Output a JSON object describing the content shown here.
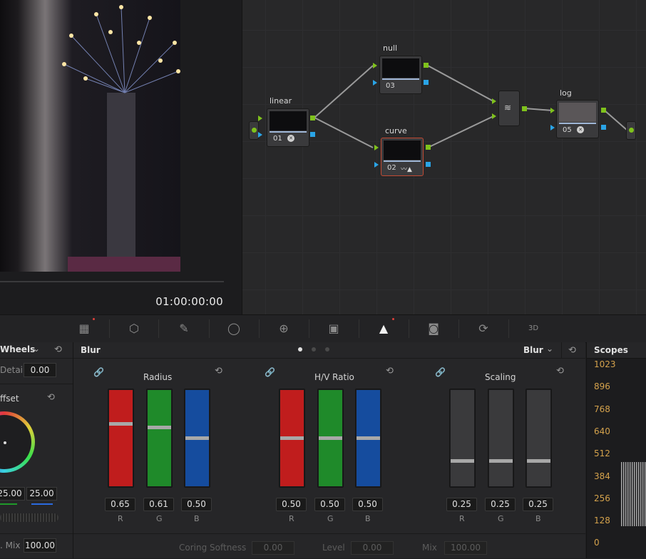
{
  "viewer": {
    "timecode": "01:00:00:00"
  },
  "nodes": [
    {
      "label": "linear",
      "number": "01"
    },
    {
      "label": "null",
      "number": "03"
    },
    {
      "label": "curve",
      "number": "02"
    },
    {
      "label": "log",
      "number": "05"
    }
  ],
  "left_panel": {
    "mode_label": "Wheels",
    "detail_label": "Detail",
    "detail_value": "0.00",
    "offset_label": "ffset",
    "wheel_values": [
      "25.00",
      "25.00"
    ],
    "mix_label": ". Mix",
    "mix_value": "100.00"
  },
  "blur_panel": {
    "title": "Blur",
    "mode_dropdown": "Blur",
    "columns": [
      {
        "title": "Radius",
        "values": [
          "0.65",
          "0.61",
          "0.50"
        ],
        "levels": [
          0.65,
          0.61,
          0.5
        ]
      },
      {
        "title": "H/V Ratio",
        "values": [
          "0.50",
          "0.50",
          "0.50"
        ],
        "levels": [
          0.5,
          0.5,
          0.5
        ]
      },
      {
        "title": "Scaling",
        "values": [
          "0.25",
          "0.25",
          "0.25"
        ],
        "levels": [
          0.25,
          0.25,
          0.25
        ]
      }
    ],
    "channels": [
      "R",
      "G",
      "B"
    ],
    "bottom": {
      "coring_label": "Coring Softness",
      "coring_value": "0.00",
      "level_label": "Level",
      "level_value": "0.00",
      "mix_label": "Mix",
      "mix_value": "100.00"
    }
  },
  "scopes": {
    "title": "Scopes",
    "ticks": [
      "1023",
      "896",
      "768",
      "640",
      "512",
      "384",
      "256",
      "128",
      "0"
    ]
  },
  "colors": {
    "red": "#c01d1d",
    "green": "#1f8a2a",
    "blue": "#154c9e",
    "grey": "#3a3a3c",
    "accent": "#c14a33"
  }
}
